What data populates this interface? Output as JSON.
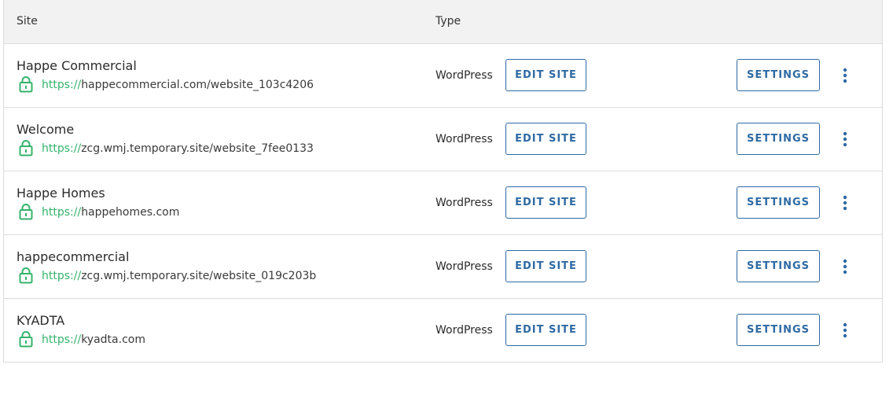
{
  "header": {
    "site_label": "Site",
    "type_label": "Type"
  },
  "rows": [
    {
      "name": "Happe Commercial",
      "url_scheme": "https://",
      "url_host": "happecommercial.com/website_103c4206",
      "type": "WordPress",
      "edit_label": "EDIT SITE",
      "settings_label": "SETTINGS"
    },
    {
      "name": "Welcome",
      "url_scheme": "https://",
      "url_host": "zcg.wmj.temporary.site/website_7fee0133",
      "type": "WordPress",
      "edit_label": "EDIT SITE",
      "settings_label": "SETTINGS"
    },
    {
      "name": "Happe Homes",
      "url_scheme": "https://",
      "url_host": "happehomes.com",
      "type": "WordPress",
      "edit_label": "EDIT SITE",
      "settings_label": "SETTINGS"
    },
    {
      "name": "happecommercial",
      "url_scheme": "https://",
      "url_host": "zcg.wmj.temporary.site/website_019c203b",
      "type": "WordPress",
      "edit_label": "EDIT SITE",
      "settings_label": "SETTINGS"
    },
    {
      "name": "KYADTA",
      "url_scheme": "https://",
      "url_host": "kyadta.com",
      "type": "WordPress",
      "edit_label": "EDIT SITE",
      "settings_label": "SETTINGS"
    }
  ],
  "icons": {
    "lock": "lock-icon",
    "more": "more-vertical-icon"
  },
  "colors": {
    "accent": "#2f6aa3",
    "secure_green": "#34b36b",
    "header_bg": "#f2f2f2",
    "border": "#dcdcdc"
  }
}
